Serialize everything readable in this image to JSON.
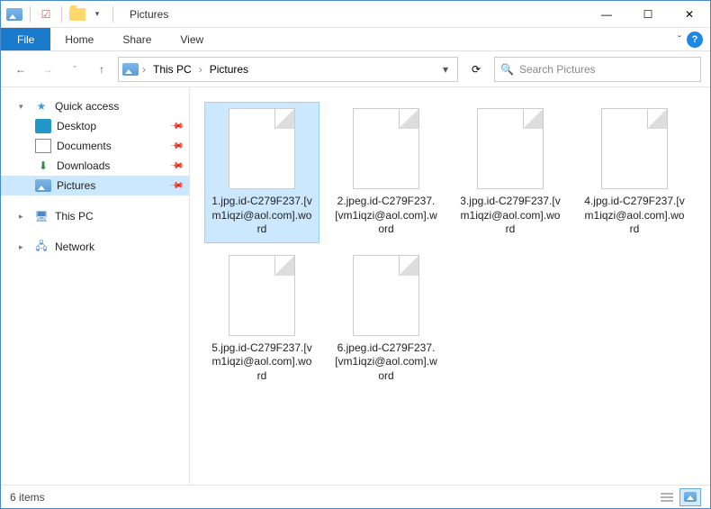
{
  "titlebar": {
    "title": "Pictures"
  },
  "window_controls": {
    "min": "—",
    "max": "☐",
    "close": "✕"
  },
  "ribbon": {
    "file": "File",
    "tabs": [
      "Home",
      "Share",
      "View"
    ],
    "expand": "ˇ",
    "help": "?"
  },
  "nav": {
    "back": "←",
    "forward": "→",
    "recent": "ˇ",
    "up": "↑",
    "crumbs": [
      "This PC",
      "Pictures"
    ],
    "crumb_sep": "›",
    "refresh": "⟳"
  },
  "search": {
    "placeholder": "Search Pictures",
    "icon": "🔍"
  },
  "sidebar": {
    "quick_access": {
      "label": "Quick access",
      "expanded": true
    },
    "items": [
      {
        "label": "Desktop",
        "icon": "desktop",
        "pinned": true
      },
      {
        "label": "Documents",
        "icon": "document",
        "pinned": true
      },
      {
        "label": "Downloads",
        "icon": "download",
        "pinned": true
      },
      {
        "label": "Pictures",
        "icon": "pictures",
        "pinned": true,
        "selected": true
      }
    ],
    "this_pc": {
      "label": "This PC"
    },
    "network": {
      "label": "Network"
    }
  },
  "files": [
    {
      "name": "1.jpg.id-C279F237.[vm1iqzi@aol.com].word",
      "selected": true
    },
    {
      "name": "2.jpeg.id-C279F237.[vm1iqzi@aol.com].word"
    },
    {
      "name": "3.jpg.id-C279F237.[vm1iqzi@aol.com].word"
    },
    {
      "name": "4.jpg.id-C279F237.[vm1iqzi@aol.com].word"
    },
    {
      "name": "5.jpg.id-C279F237.[vm1iqzi@aol.com].word"
    },
    {
      "name": "6.jpeg.id-C279F237.[vm1iqzi@aol.com].word"
    }
  ],
  "status": {
    "item_count": "6 items"
  }
}
